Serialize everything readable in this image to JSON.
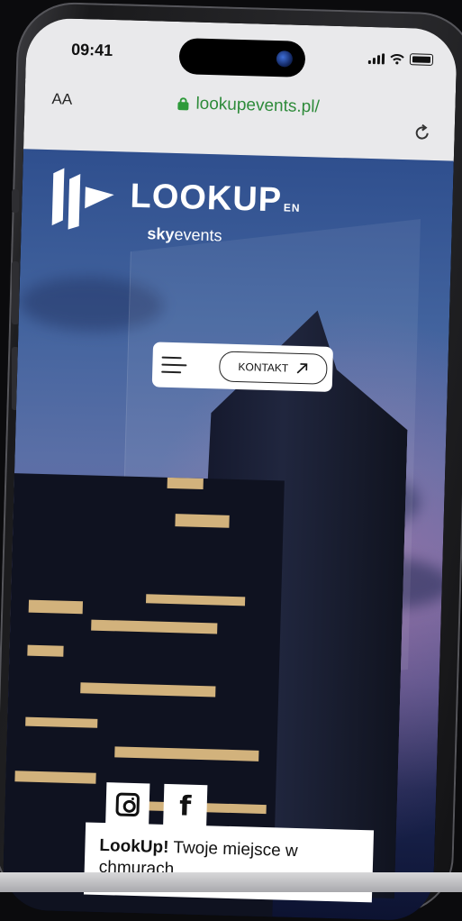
{
  "status_bar": {
    "time": "09:41"
  },
  "browser": {
    "text_size_label": "AA",
    "url": "lookupevents.pl/"
  },
  "site": {
    "brand_main": "LOOKUP",
    "brand_lang": "EN",
    "brand_sub_bold": "sky",
    "brand_sub": "events",
    "contact_button": "KONTAKT",
    "tagline_bold": "LookUp!",
    "tagline": "Twoje miejsce w chmurach"
  },
  "colors": {
    "url_green": "#2e8b3a",
    "lock_green": "#2e9a3a"
  },
  "icons": [
    "lock-icon",
    "reload-icon",
    "menu-icon",
    "arrow-up-right-icon",
    "instagram-icon",
    "facebook-icon",
    "signal-icon",
    "wifi-icon",
    "battery-icon"
  ]
}
